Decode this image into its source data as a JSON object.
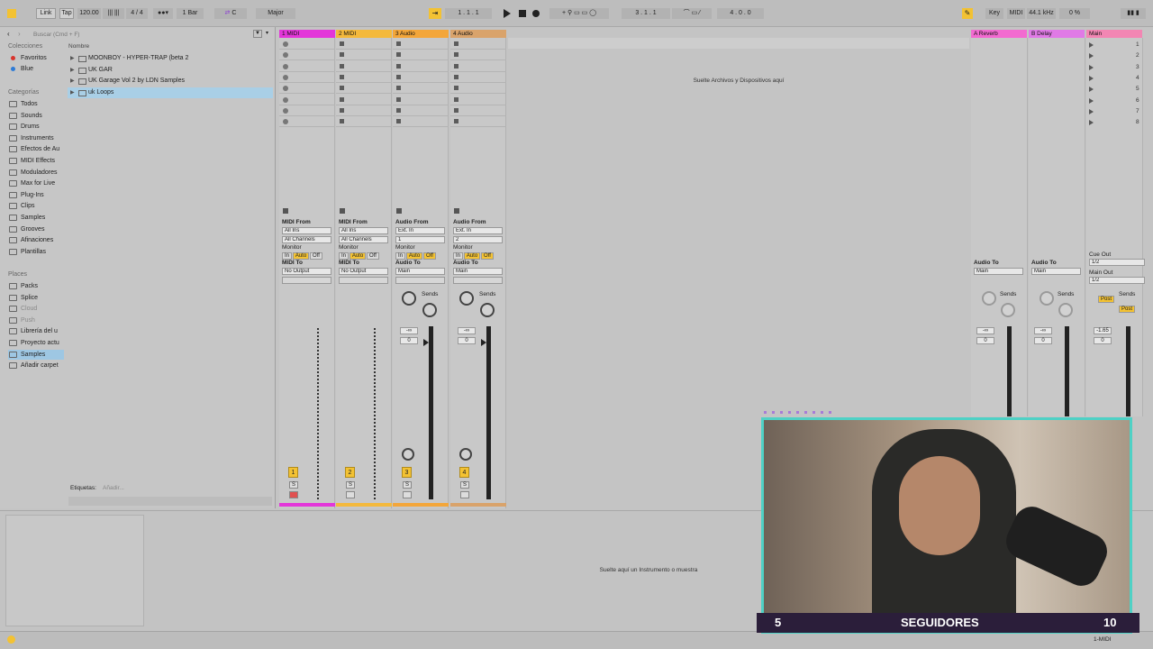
{
  "transport": {
    "link": "Link",
    "tap": "Tap",
    "tempo": "120.00",
    "signature": "4 / 4",
    "quantize": "1 Bar",
    "key_root": "C",
    "scale": "Major",
    "position": "1 . 1 . 1",
    "loop_start": "3 . 1 . 1",
    "loop_length": "4 . 0 . 0"
  },
  "top_right": {
    "key": "Key",
    "midi": "MIDI",
    "sample_rate": "44.1 kHz",
    "cpu": "0 %"
  },
  "browser": {
    "search_placeholder": "Buscar (Cmd + F)",
    "col_header": "Nombre",
    "collections_title": "Colecciones",
    "collections": [
      {
        "label": "Favoritos",
        "color": "#d8342c"
      },
      {
        "label": "Blue",
        "color": "#2e7bd6"
      }
    ],
    "categories_title": "Categorías",
    "categories": [
      "Todos",
      "Sounds",
      "Drums",
      "Instruments",
      "Efectos de Au",
      "MIDI Effects",
      "Moduladores",
      "Max for Live",
      "Plug-Ins",
      "Clips",
      "Samples",
      "Grooves",
      "Afinaciones",
      "Plantillas"
    ],
    "places_title": "Places",
    "places": [
      "Packs",
      "Splice",
      "Cloud",
      "Push",
      "Librería del u",
      "Proyecto actu",
      "Samples",
      "Añadir carpet"
    ],
    "files": [
      "MOONBOY - HYPER-TRAP (beta 2",
      "UK GAR",
      "UK Garage Vol 2 by LDN Samples",
      "uk Loops"
    ],
    "tags_label": "Etiquetas:",
    "tags_add": "Añadir..."
  },
  "tracks": [
    {
      "name": "1 MIDI",
      "color": "#e336d9",
      "from_label": "MIDI From",
      "from": "All Ins",
      "channel": "All Channels",
      "to_label": "MIDI To",
      "to": "No Output",
      "num": "1"
    },
    {
      "name": "2 MIDI",
      "color": "#f4b93c",
      "from_label": "MIDI From",
      "from": "All Ins",
      "channel": "All Channels",
      "to_label": "MIDI To",
      "to": "No Output",
      "num": "2"
    },
    {
      "name": "3 Audio",
      "color": "#f3a63a",
      "from_label": "Audio From",
      "from": "Ext. In",
      "channel": "1",
      "to_label": "Audio To",
      "to": "Main",
      "num": "3"
    },
    {
      "name": "4 Audio",
      "color": "#d9a36b",
      "from_label": "Audio From",
      "from": "Ext. In",
      "channel": "2",
      "to_label": "Audio To",
      "to": "Main",
      "num": "4"
    }
  ],
  "returns": [
    {
      "name": "A Reverb",
      "color": "#f26ad0",
      "to_label": "Audio To",
      "to": "Main"
    },
    {
      "name": "B Delay",
      "color": "#e07ae6",
      "to_label": "Audio To",
      "to": "Main"
    },
    {
      "name": "Main",
      "color": "#f286b3"
    }
  ],
  "main": {
    "cue_out_label": "Cue Out",
    "cue_out": "1/2",
    "main_out_label": "Main Out",
    "main_out": "1/2",
    "post": "Post",
    "volume": "-1.65",
    "scene_numbers": [
      "1",
      "2",
      "3",
      "4",
      "5",
      "6",
      "7",
      "8"
    ]
  },
  "monitor": {
    "label": "Monitor",
    "in": "In",
    "auto": "Auto",
    "off": "Off"
  },
  "mixer": {
    "sends": "Sends",
    "vol_inf": "-∞",
    "pan": "0",
    "solo": "S"
  },
  "drop_zone_session": "Suelte Archivos y Dispositivos aquí",
  "drop_zone_detail": "Suelte aquí un Instrumento o muestra",
  "status_right": "1-MIDI",
  "overlay": {
    "left_count": "5",
    "label": "SEGUIDORES",
    "right_count": "10"
  }
}
